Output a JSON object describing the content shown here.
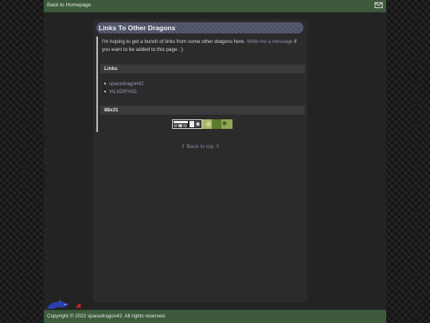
{
  "topbar": {
    "home_label": "Back to Homepage",
    "mail_icon": "envelope-icon"
  },
  "card": {
    "title": "Links To Other Dragons"
  },
  "intro": {
    "text_before": "I'm hoping to get a bunch of links from some other dragons here. ",
    "link_label": "Write me a message",
    "text_after": " if you want to be added to this page. :)"
  },
  "links_section": {
    "title": "Links",
    "items": [
      {
        "label": "spacedragon42"
      },
      {
        "label": "ViLXDRYAD"
      }
    ]
  },
  "buttons_section": {
    "title": "88x31",
    "buttons": [
      {
        "label": "button 1"
      },
      {
        "label": "button 2"
      }
    ]
  },
  "back_to_top": "⇧ Back to top ⇧",
  "footer": {
    "copyright": "Copyright © 2022 spacedragon42. All rights reserved."
  },
  "colors": {
    "accent": "#3d5a3d",
    "title_bar": "#4a4f66",
    "link": "#8f90b0"
  }
}
